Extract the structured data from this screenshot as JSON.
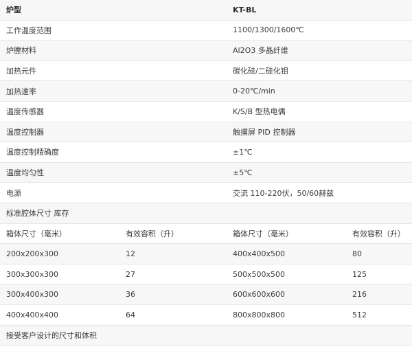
{
  "header": {
    "label": "炉型",
    "value": "KT-BL"
  },
  "specs": [
    {
      "label": "工作温度范围",
      "value": "1100/1300/1600℃"
    },
    {
      "label": "炉膛材料",
      "value": "Al2O3 多晶纤维"
    },
    {
      "label": "加热元件",
      "value": "碳化硅/二硅化钼"
    },
    {
      "label": "加热速率",
      "value": "0-20℃/min"
    },
    {
      "label": "温度传感器",
      "value": "K/S/B 型热电偶"
    },
    {
      "label": "温度控制器",
      "value": "触摸屏 PID 控制器"
    },
    {
      "label": "温度控制精确度",
      "value": "±1℃"
    },
    {
      "label": "温度均匀性",
      "value": "±5℃"
    },
    {
      "label": "电源",
      "value": "交流 110-220伏，50/60赫兹"
    }
  ],
  "chamber_section": {
    "title": "标准腔体尺寸 库存"
  },
  "chamber_table": {
    "headers": [
      "箱体尺寸（毫米）",
      "有效容积（升）",
      "箱体尺寸（毫米）",
      "有效容积（升）"
    ],
    "rows": [
      [
        "200x200x300",
        "12",
        "400x400x500",
        "80"
      ],
      [
        "300x300x300",
        "27",
        "500x500x500",
        "125"
      ],
      [
        "300x400x300",
        "36",
        "600x600x600",
        "216"
      ],
      [
        "400x400x400",
        "64",
        "800x800x800",
        "512"
      ]
    ]
  },
  "footer": {
    "note": "接受客户设计的尺寸和体积"
  }
}
